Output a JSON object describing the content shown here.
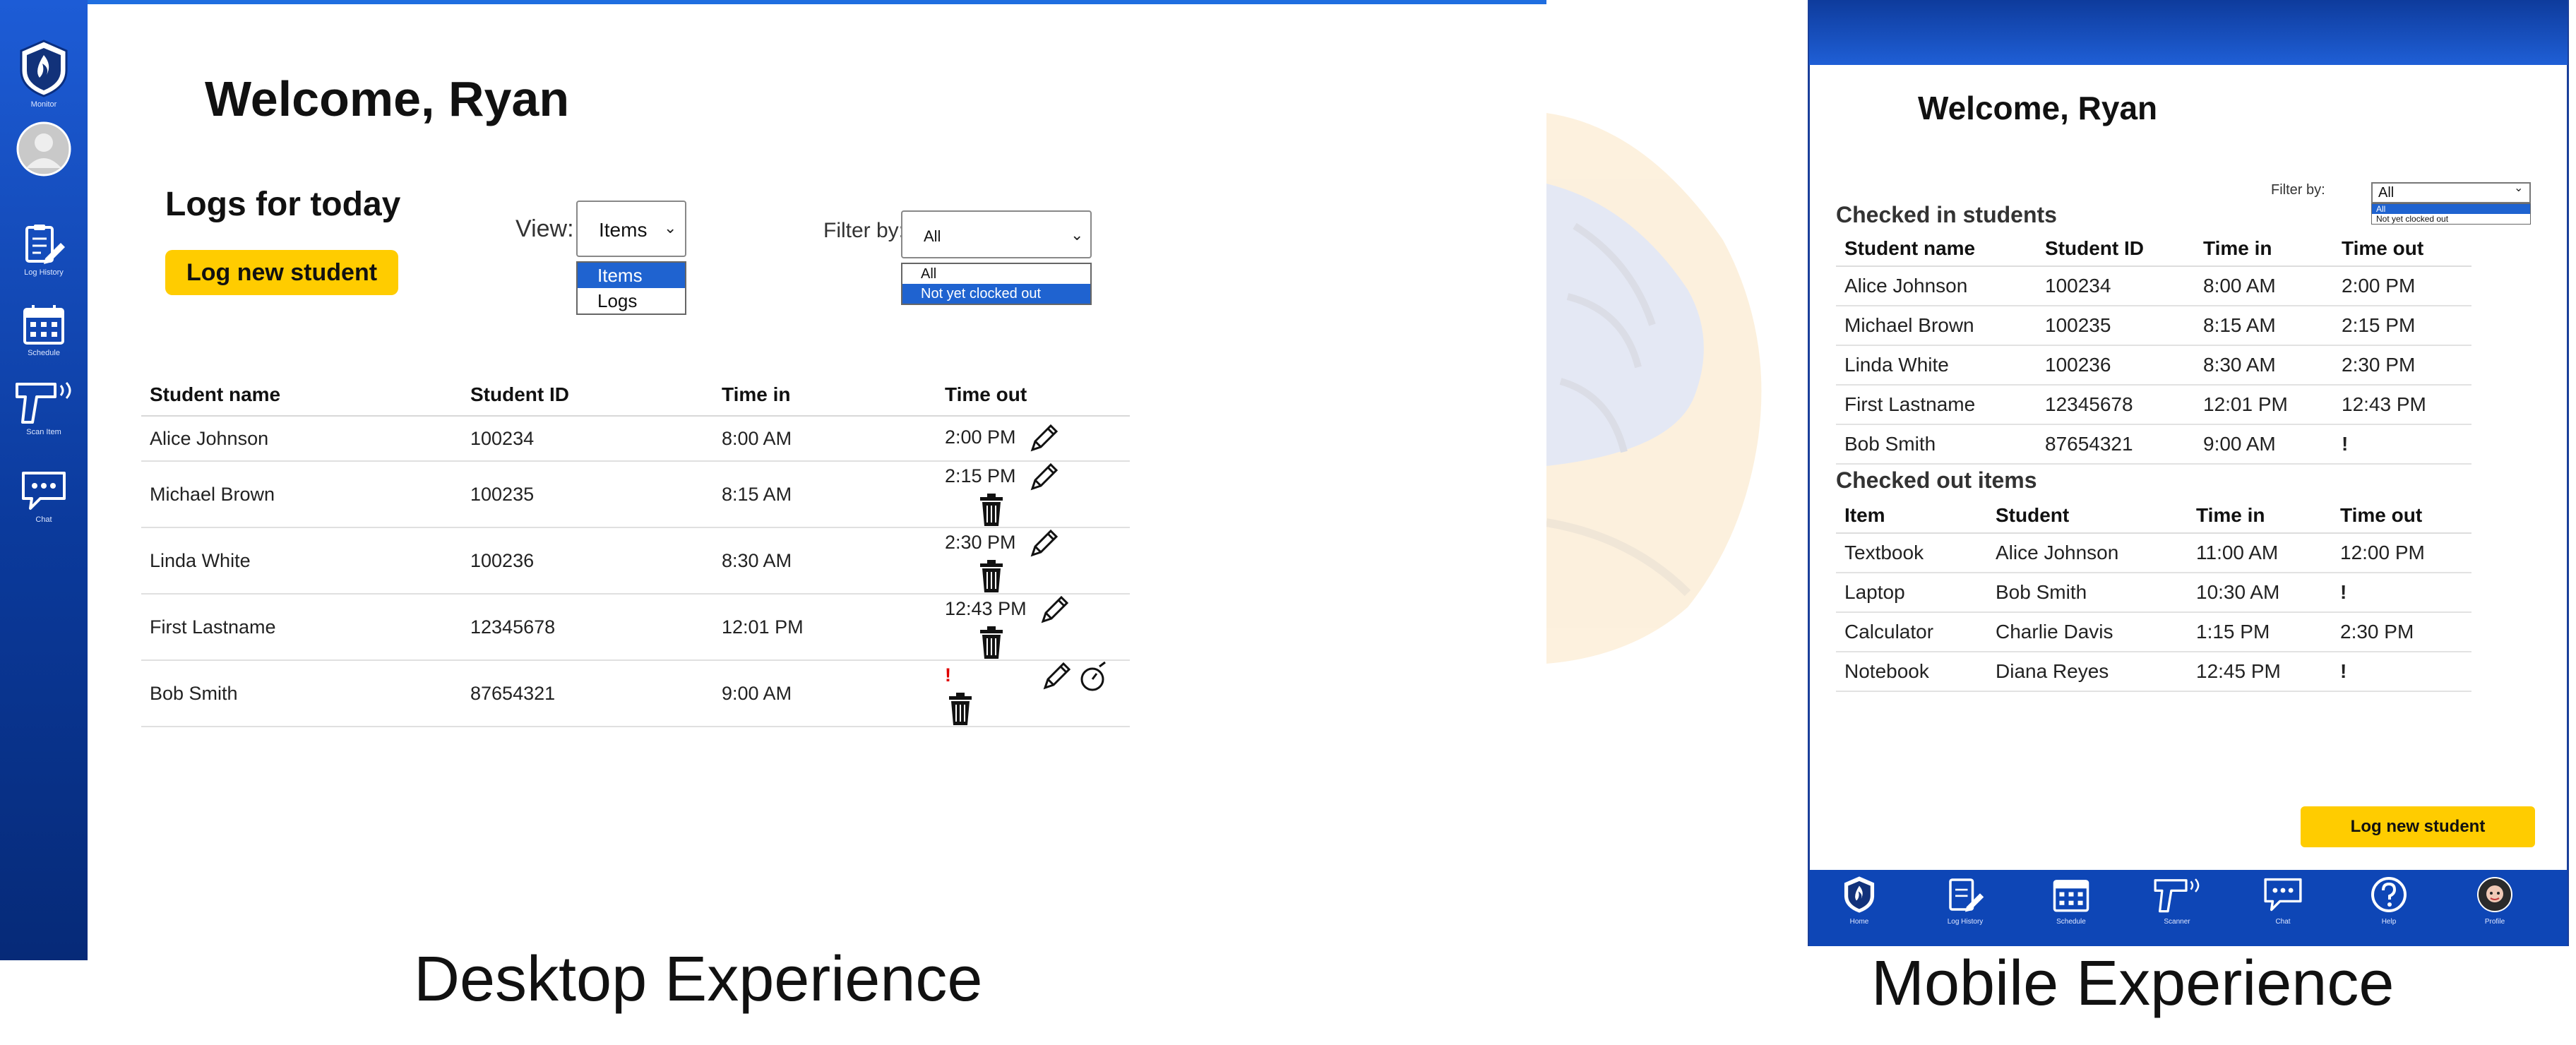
{
  "desktop": {
    "caption": "Desktop Experience",
    "welcome": "Welcome, Ryan",
    "logs_title": "Logs for today",
    "log_button": "Log new student",
    "sidebar": [
      {
        "label": "Monitor",
        "icon": "flame-logo-icon"
      },
      {
        "label": "",
        "icon": "avatar-icon"
      },
      {
        "label": "Log History",
        "icon": "clipboard-edit-icon"
      },
      {
        "label": "Schedule",
        "icon": "calendar-icon"
      },
      {
        "label": "Scan Item",
        "icon": "scanner-gun-icon"
      },
      {
        "label": "Chat",
        "icon": "chat-bubble-icon"
      }
    ],
    "view": {
      "label": "View:",
      "value": "Items",
      "options": [
        "Items",
        "Logs"
      ],
      "highlighted": "Items"
    },
    "filter": {
      "label": "Filter by:",
      "value": "All",
      "options": [
        "All",
        "Not yet clocked out"
      ],
      "highlighted": "Not yet clocked out"
    },
    "table": {
      "columns": [
        "Student name",
        "Student ID",
        "Time in",
        "Time out"
      ],
      "rows": [
        {
          "name": "Alice Johnson",
          "id": "100234",
          "time_in": "8:00 AM",
          "time_out": "2:00 PM"
        },
        {
          "name": "Michael Brown",
          "id": "100235",
          "time_in": "8:15 AM",
          "time_out": "2:15 PM"
        },
        {
          "name": "Linda White",
          "id": "100236",
          "time_in": "8:30 AM",
          "time_out": "2:30 PM"
        },
        {
          "name": "First Lastname",
          "id": "12345678",
          "time_in": "12:01 PM",
          "time_out": "12:43 PM"
        },
        {
          "name": "Bob Smith",
          "id": "87654321",
          "time_in": "9:00 AM",
          "time_out": "!"
        }
      ]
    }
  },
  "mobile": {
    "caption": "Mobile Experience",
    "welcome": "Welcome, Ryan",
    "filter": {
      "label": "Filter by:",
      "value": "All",
      "options": [
        "All",
        "Not yet clocked out"
      ],
      "highlighted": "All"
    },
    "students": {
      "title": "Checked in students",
      "columns": [
        "Student name",
        "Student ID",
        "Time in",
        "Time out"
      ],
      "rows": [
        {
          "name": "Alice Johnson",
          "id": "100234",
          "time_in": "8:00 AM",
          "time_out": "2:00 PM"
        },
        {
          "name": "Michael Brown",
          "id": "100235",
          "time_in": "8:15 AM",
          "time_out": "2:15 PM"
        },
        {
          "name": "Linda White",
          "id": "100236",
          "time_in": "8:30 AM",
          "time_out": "2:30 PM"
        },
        {
          "name": "First Lastname",
          "id": "12345678",
          "time_in": "12:01 PM",
          "time_out": "12:43 PM"
        },
        {
          "name": "Bob Smith",
          "id": "87654321",
          "time_in": "9:00 AM",
          "time_out": "!"
        }
      ]
    },
    "items": {
      "title": "Checked out items",
      "columns": [
        "Item",
        "Student",
        "Time in",
        "Time out"
      ],
      "rows": [
        {
          "item": "Textbook",
          "student": "Alice Johnson",
          "time_in": "11:00 AM",
          "time_out": "12:00 PM"
        },
        {
          "item": "Laptop",
          "student": "Bob Smith",
          "time_in": "10:30 AM",
          "time_out": "!"
        },
        {
          "item": "Calculator",
          "student": "Charlie Davis",
          "time_in": "1:15 PM",
          "time_out": "2:30 PM"
        },
        {
          "item": "Notebook",
          "student": "Diana Reyes",
          "time_in": "12:45 PM",
          "time_out": "!"
        }
      ]
    },
    "log_button": "Log new student",
    "nav": [
      {
        "label": "Home",
        "icon": "flame-logo-icon"
      },
      {
        "label": "Log History",
        "icon": "clipboard-edit-icon"
      },
      {
        "label": "Schedule",
        "icon": "calendar-icon"
      },
      {
        "label": "Scanner",
        "icon": "scanner-gun-icon"
      },
      {
        "label": "Chat",
        "icon": "chat-bubble-icon"
      },
      {
        "label": "Help",
        "icon": "help-icon"
      },
      {
        "label": "Profile",
        "icon": "profile-avatar-icon"
      }
    ]
  },
  "colors": {
    "brand_blue": "#1f5fd6",
    "accent_yellow": "#ffcc00",
    "alert_red": "#e00000"
  }
}
